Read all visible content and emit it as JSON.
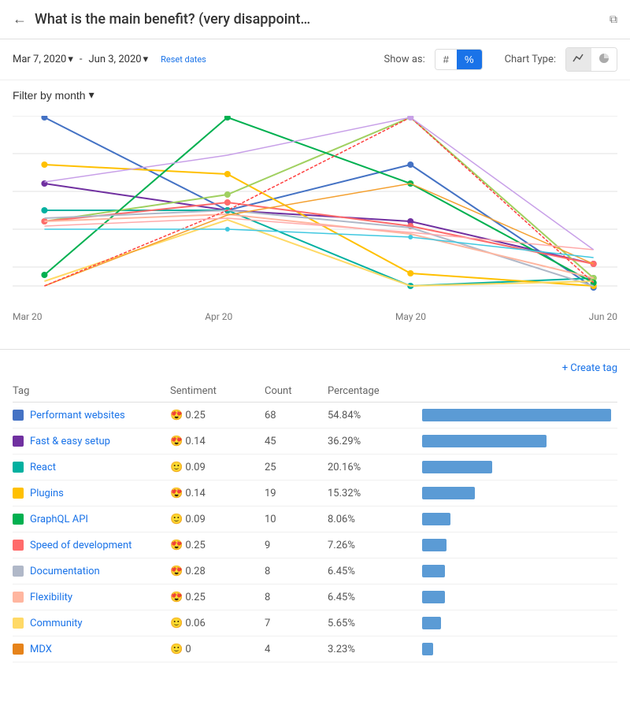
{
  "header": {
    "back_label": "←",
    "title": "What is the main benefit? (very disappoint…",
    "external_icon": "⧉"
  },
  "toolbar": {
    "date_start": "Mar 7, 2020",
    "date_end": "Jun 3, 2020",
    "reset_label": "Reset dates",
    "show_as_label": "Show as:",
    "hash_label": "#",
    "percent_label": "%",
    "chart_type_label": "Chart Type:",
    "line_icon": "📈",
    "pie_icon": "🥧"
  },
  "filter": {
    "label": "Filter by month"
  },
  "chart": {
    "x_labels": [
      "Mar 20",
      "Apr 20",
      "May 20",
      "Jun 20"
    ]
  },
  "create_tag": "+ Create tag",
  "table": {
    "headers": [
      "Tag",
      "Sentiment",
      "Count",
      "Percentage",
      ""
    ],
    "rows": [
      {
        "name": "Performant websites",
        "color": "#4472c4",
        "sentiment": "😍 0.25",
        "count": "68",
        "pct": "54.84%",
        "bar_pct": 100
      },
      {
        "name": "Fast & easy setup",
        "color": "#7030a0",
        "sentiment": "😍 0.14",
        "count": "45",
        "pct": "36.29%",
        "bar_pct": 66
      },
      {
        "name": "React",
        "color": "#00b0a0",
        "sentiment": "🙂 0.09",
        "count": "25",
        "pct": "20.16%",
        "bar_pct": 37
      },
      {
        "name": "Plugins",
        "color": "#ffc000",
        "sentiment": "😍 0.14",
        "count": "19",
        "pct": "15.32%",
        "bar_pct": 28
      },
      {
        "name": "GraphQL API",
        "color": "#00b050",
        "sentiment": "🙂 0.09",
        "count": "10",
        "pct": "8.06%",
        "bar_pct": 15
      },
      {
        "name": "Speed of development",
        "color": "#ff6b6b",
        "sentiment": "😍 0.25",
        "count": "9",
        "pct": "7.26%",
        "bar_pct": 13
      },
      {
        "name": "Documentation",
        "color": "#b0b8c8",
        "sentiment": "😍 0.28",
        "count": "8",
        "pct": "6.45%",
        "bar_pct": 12
      },
      {
        "name": "Flexibility",
        "color": "#ffb6a0",
        "sentiment": "😍 0.25",
        "count": "8",
        "pct": "6.45%",
        "bar_pct": 12
      },
      {
        "name": "Community",
        "color": "#ffd966",
        "sentiment": "🙂 0.06",
        "count": "7",
        "pct": "5.65%",
        "bar_pct": 10
      },
      {
        "name": "MDX",
        "color": "#e6831a",
        "sentiment": "🙂 0",
        "count": "4",
        "pct": "3.23%",
        "bar_pct": 6
      }
    ]
  }
}
